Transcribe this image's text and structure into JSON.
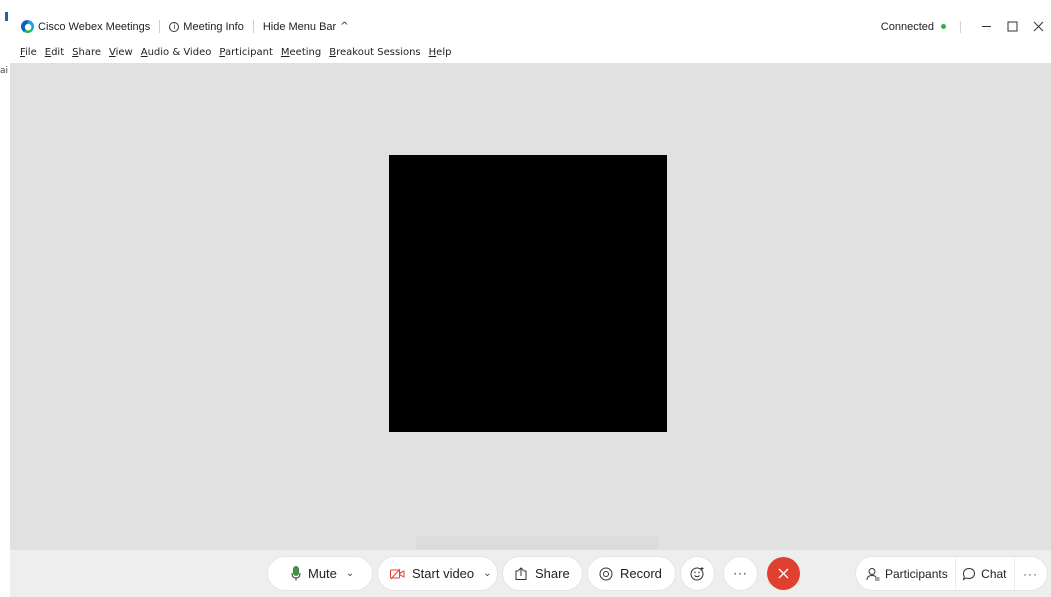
{
  "titlebar": {
    "app_name": "Cisco Webex Meetings",
    "meeting_info": "Meeting Info",
    "hide_menu_bar": "Hide Menu Bar",
    "status_text": "Connected",
    "status_color": "#2fb44a"
  },
  "menubar": {
    "items": [
      {
        "key": "F",
        "rest": "ile"
      },
      {
        "key": "E",
        "rest": "dit"
      },
      {
        "key": "S",
        "rest": "hare"
      },
      {
        "key": "V",
        "rest": "iew"
      },
      {
        "key": "A",
        "rest": "udio & Video"
      },
      {
        "key": "P",
        "rest": "articipant"
      },
      {
        "key": "M",
        "rest": "eeting"
      },
      {
        "key": "B",
        "rest": "reakout Sessions"
      },
      {
        "key": "H",
        "rest": "elp"
      }
    ]
  },
  "left_strip": {
    "glyph": "ai"
  },
  "controls": {
    "mute_label": "Mute",
    "start_video_label": "Start video",
    "share_label": "Share",
    "record_label": "Record",
    "participants_label": "Participants",
    "chat_label": "Chat",
    "end_color": "#e0402f",
    "mic_color": "#2a8a2a",
    "video_off_color": "#e0402f"
  },
  "icons": {
    "app_logo": "webex-logo-icon",
    "info": "info-icon",
    "caret_up": "chevron-up-icon",
    "minimize": "minimize-icon",
    "maximize": "maximize-icon",
    "close": "close-icon",
    "mic": "microphone-icon",
    "video_off": "video-off-icon",
    "share": "share-icon",
    "record": "record-icon",
    "reactions": "smiley-icon",
    "more": "more-icon",
    "end": "end-call-icon",
    "participants": "participants-icon",
    "chat": "chat-icon"
  }
}
